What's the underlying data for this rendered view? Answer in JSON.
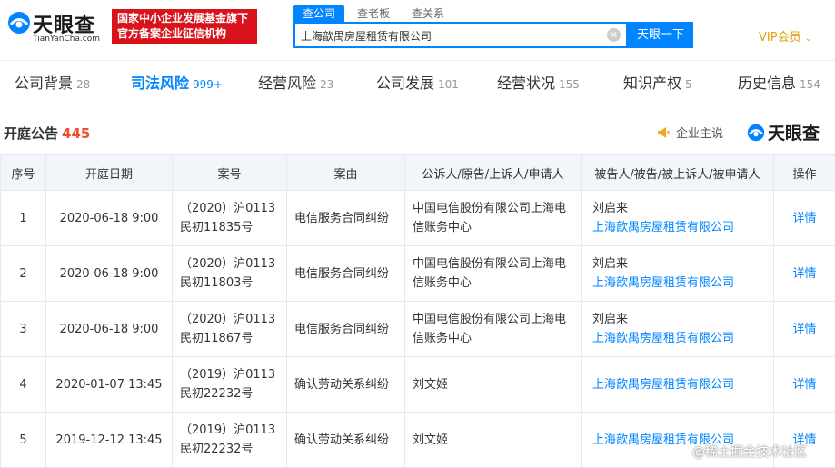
{
  "header": {
    "logo_text": "天眼查",
    "logo_sub": "TianYanCha.com",
    "gov_badge_line1": "国家中小企业发展基金旗下",
    "gov_badge_line2": "官方备案企业征信机构",
    "search_tabs": [
      "查公司",
      "查老板",
      "查关系"
    ],
    "search_value": "上海歆禺房屋租赁有限公司",
    "search_button": "天眼一下",
    "vip_label": "VIP会员"
  },
  "nav": {
    "tabs": [
      {
        "label": "公司背景",
        "count": "28"
      },
      {
        "label": "司法风险",
        "count": "999+"
      },
      {
        "label": "经营风险",
        "count": "23"
      },
      {
        "label": "公司发展",
        "count": "101"
      },
      {
        "label": "经营状况",
        "count": "155"
      },
      {
        "label": "知识产权",
        "count": "5"
      },
      {
        "label": "历史信息",
        "count": "154"
      }
    ]
  },
  "section": {
    "title": "开庭公告",
    "count": "445",
    "promo_label": "企业主说",
    "brand": "天眼查"
  },
  "table": {
    "headers": [
      "序号",
      "开庭日期",
      "案号",
      "案由",
      "公诉人/原告/上诉人/申请人",
      "被告人/被告/被上诉人/被申请人",
      "操作"
    ],
    "rows": [
      {
        "idx": "1",
        "date": "2020-06-18 9:00",
        "case_no": "（2020）沪0113民初11835号",
        "reason": "电信服务合同纠纷",
        "plaintiff": "中国电信股份有限公司上海电信账务中心",
        "defendant_person": "刘启来",
        "defendant_company": "上海歆禺房屋租赁有限公司",
        "action": "详情"
      },
      {
        "idx": "2",
        "date": "2020-06-18 9:00",
        "case_no": "（2020）沪0113民初11803号",
        "reason": "电信服务合同纠纷",
        "plaintiff": "中国电信股份有限公司上海电信账务中心",
        "defendant_person": "刘启来",
        "defendant_company": "上海歆禺房屋租赁有限公司",
        "action": "详情"
      },
      {
        "idx": "3",
        "date": "2020-06-18 9:00",
        "case_no": "（2020）沪0113民初11867号",
        "reason": "电信服务合同纠纷",
        "plaintiff": "中国电信股份有限公司上海电信账务中心",
        "defendant_person": "刘启来",
        "defendant_company": "上海歆禺房屋租赁有限公司",
        "action": "详情"
      },
      {
        "idx": "4",
        "date": "2020-01-07 13:45",
        "case_no": "（2019）沪0113民初22232号",
        "reason": "确认劳动关系纠纷",
        "plaintiff": "刘文姬",
        "defendant_person": "",
        "defendant_company": "上海歆禺房屋租赁有限公司",
        "action": "详情"
      },
      {
        "idx": "5",
        "date": "2019-12-12 13:45",
        "case_no": "（2019）沪0113民初22232号",
        "reason": "确认劳动关系纠纷",
        "plaintiff": "刘文姬",
        "defendant_person": "",
        "defendant_company": "上海歆禺房屋租赁有限公司",
        "action": "详情"
      }
    ]
  },
  "watermark": "@稀土掘金技术社区"
}
